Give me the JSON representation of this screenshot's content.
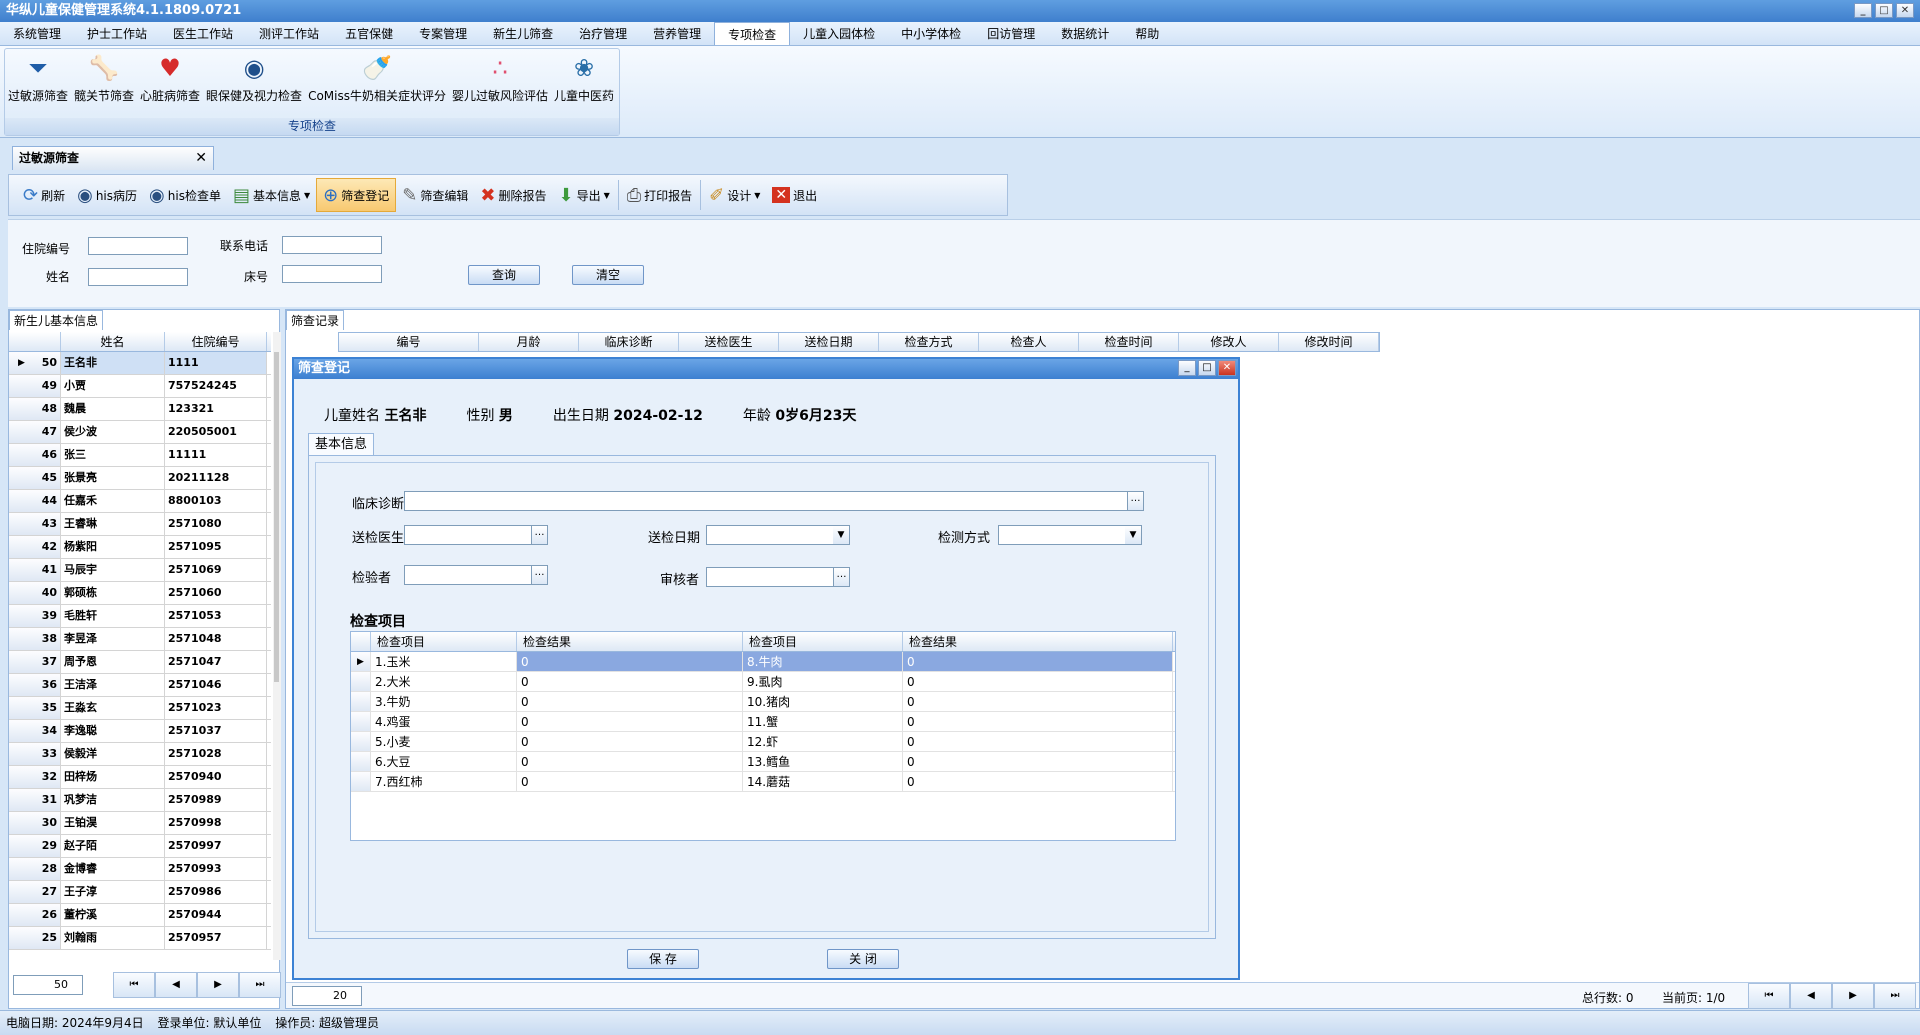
{
  "app": {
    "title": "华纵儿童保健管理系统4.1.1809.0721"
  },
  "menu": [
    "系统管理",
    "护士工作站",
    "医生工作站",
    "测评工作站",
    "五官保健",
    "专案管理",
    "新生儿筛查",
    "治疗管理",
    "营养管理",
    "专项检查",
    "儿童入园体检",
    "中小学体检",
    "回访管理",
    "数据统计",
    "帮助"
  ],
  "menu_active": 9,
  "ribbon": {
    "group_label": "专项检查",
    "items": [
      {
        "label": "过敏源筛查",
        "icon": "funnel-icon"
      },
      {
        "label": "髋关节筛查",
        "icon": "bone-icon"
      },
      {
        "label": "心脏病筛查",
        "icon": "heart-icon"
      },
      {
        "label": "眼保健及视力检查",
        "icon": "eye-icon"
      },
      {
        "label": "CoMiss牛奶相关症状评分",
        "icon": "milk-bottle-icon"
      },
      {
        "label": "婴儿过敏风险评估",
        "icon": "allergy-icon"
      },
      {
        "label": "儿童中医药",
        "icon": "herb-icon"
      }
    ]
  },
  "doc_tab": {
    "label": "过敏源筛查"
  },
  "toolbar": {
    "refresh": "刷新",
    "his_record": "his病历",
    "his_exam": "his检查单",
    "basic_info": "基本信息",
    "register": "筛查登记",
    "edit": "筛查编辑",
    "delete_report": "删除报告",
    "export": "导出",
    "print_report": "打印报告",
    "design": "设计",
    "exit": "退出"
  },
  "search": {
    "inpatient_no": "住院编号",
    "phone": "联系电话",
    "name": "姓名",
    "bed": "床号",
    "query_btn": "查询",
    "clear_btn": "清空"
  },
  "left_panel": {
    "tab": "新生儿基本信息",
    "headers": [
      "姓名",
      "住院编号"
    ],
    "rows": [
      {
        "n": "50",
        "name": "王名非",
        "id": "1111"
      },
      {
        "n": "49",
        "name": "小贾",
        "id": "757524245"
      },
      {
        "n": "48",
        "name": "魏晨",
        "id": "123321"
      },
      {
        "n": "47",
        "name": "侯少波",
        "id": "220505001"
      },
      {
        "n": "46",
        "name": "张三",
        "id": "11111"
      },
      {
        "n": "45",
        "name": "张景亮",
        "id": "20211128"
      },
      {
        "n": "44",
        "name": "任嘉禾",
        "id": "8800103"
      },
      {
        "n": "43",
        "name": "王睿琳",
        "id": "2571080"
      },
      {
        "n": "42",
        "name": "杨紫阳",
        "id": "2571095"
      },
      {
        "n": "41",
        "name": "马辰宇",
        "id": "2571069"
      },
      {
        "n": "40",
        "name": "郭硕栋",
        "id": "2571060"
      },
      {
        "n": "39",
        "name": "毛胜轩",
        "id": "2571053"
      },
      {
        "n": "38",
        "name": "李昱泽",
        "id": "2571048"
      },
      {
        "n": "37",
        "name": "周予恩",
        "id": "2571047"
      },
      {
        "n": "36",
        "name": "王洁泽",
        "id": "2571046"
      },
      {
        "n": "35",
        "name": "王淼玄",
        "id": "2571023"
      },
      {
        "n": "34",
        "name": "李逸聪",
        "id": "2571037"
      },
      {
        "n": "33",
        "name": "侯毅洋",
        "id": "2571028"
      },
      {
        "n": "32",
        "name": "田梓炀",
        "id": "2570940"
      },
      {
        "n": "31",
        "name": "巩梦洁",
        "id": "2570989"
      },
      {
        "n": "30",
        "name": "王铂淏",
        "id": "2570998"
      },
      {
        "n": "29",
        "name": "赵子陌",
        "id": "2570997"
      },
      {
        "n": "28",
        "name": "金博睿",
        "id": "2570993"
      },
      {
        "n": "27",
        "name": "王子淳",
        "id": "2570986"
      },
      {
        "n": "26",
        "name": "董柠溪",
        "id": "2570944"
      },
      {
        "n": "25",
        "name": "刘翰雨",
        "id": "2570957"
      }
    ],
    "page_size": "50",
    "page_text": "当前页: 1/0"
  },
  "right_panel": {
    "tab": "筛查记录",
    "headers": [
      "编号",
      "月龄",
      "临床诊断",
      "送检医生",
      "送检日期",
      "检查方式",
      "检查人",
      "检查时间",
      "修改人",
      "修改时间"
    ],
    "page_size": "20",
    "total": "总行数: 0",
    "current": "当前页: 1/0"
  },
  "dialog": {
    "title": "筛查登记",
    "child_name_label": "儿童姓名",
    "child_name": "王名非",
    "gender_label": "性别",
    "gender": "男",
    "dob_label": "出生日期",
    "dob": "2024-02-12",
    "age_label": "年龄",
    "age": "0岁6月23天",
    "tab": "基本信息",
    "clinical_diag": "临床诊断",
    "doctor": "送检医生",
    "date": "送检日期",
    "method": "检测方式",
    "tester": "检验者",
    "reviewer": "审核者",
    "items_title": "检查项目",
    "grid_headers": [
      "检查项目",
      "检查结果",
      "检查项目",
      "检查结果"
    ],
    "grid_rows": [
      [
        "1.玉米",
        "0",
        "8.牛肉",
        "0"
      ],
      [
        "2.大米",
        "0",
        "9.虱肉",
        "0"
      ],
      [
        "3.牛奶",
        "0",
        "10.猪肉",
        "0"
      ],
      [
        "4.鸡蛋",
        "0",
        "11.蟹",
        "0"
      ],
      [
        "5.小麦",
        "0",
        "12.虾",
        "0"
      ],
      [
        "6.大豆",
        "0",
        "13.鳕鱼",
        "0"
      ],
      [
        "7.西红柿",
        "0",
        "14.蘑菇",
        "0"
      ]
    ],
    "save": "保 存",
    "close": "关 闭"
  },
  "status": {
    "date": "电脑日期: 2024年9月4日",
    "unit": "登录单位: 默认单位",
    "operator": "操作员: 超级管理员"
  },
  "colors": {
    "accent": "#3c82d4",
    "selected_row": "#8aa8e0",
    "active_tool": "#f8c970"
  }
}
